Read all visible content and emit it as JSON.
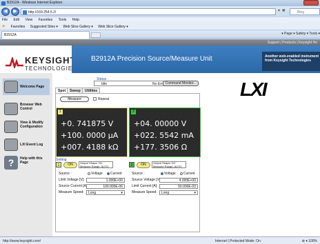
{
  "browser": {
    "window_title": "B2912A - Windows Internet Explorer",
    "url": "http://169.254.5.2/",
    "search_placeholder": "Bing",
    "menu": [
      "File",
      "Edit",
      "View",
      "Favorites",
      "Tools",
      "Help"
    ],
    "favorites": [
      "Favorites",
      "Suggested Sites ▾",
      "Web Slice Gallery ▾",
      "Web Slice Gallery ▾"
    ],
    "tab_title": "B2912A",
    "command_bar": "▾ Page ▾  Safety ▾  Tools ▾",
    "status_url": "http://www.keysight.com/",
    "status_zone": "Internet | Protected Mode: On",
    "zoom": "⊕ ▾ 100%"
  },
  "page": {
    "support_links": "Support | Products | Keysight Ho",
    "logo_top": "KEYSIGHT",
    "logo_bottom": "TECHNOLOGIES",
    "title": "B2912A Precision Source/Measure Unit",
    "promo": "Another web-enabled instrument from Keysight Technologies",
    "lxi": "LXI",
    "sidebar": [
      {
        "label": "Welcome Page"
      },
      {
        "label": "Browser Web Control"
      },
      {
        "label": "View & Modify Configuration"
      },
      {
        "label": "LXI Event Log"
      },
      {
        "label": "Help with this Page"
      }
    ],
    "status_label": "Status",
    "status_value": "Idle",
    "status_errors": "No Errors",
    "command_monitor": "Command Monitor...",
    "tabs": [
      "Spot",
      "Sweep",
      "Utilities"
    ],
    "measure_button": "Measure",
    "repeat_label": "Repeat",
    "setting_label": "Setting",
    "channels": [
      {
        "number": "1",
        "color": "#f2ec7a",
        "voltage": "+0. 741875   V",
        "current": "+100. 0000 μA",
        "resistance": "+007. 4188 kΩ",
        "on_label": "ON",
        "output_info": "Output Shape: DC\nMeasure Range: AUTO",
        "source_label": "Source :",
        "source_options": [
          "Voltage",
          "Current"
        ],
        "source_selected": "Current",
        "limit_label": "Limit Voltage [V]:",
        "limit_value": "1.000E+00",
        "level_label": "Source Current [A]:",
        "level_value": "100.000E-06",
        "speed_label": "Measure Speed:",
        "speed_value": "Long"
      },
      {
        "number": "2",
        "color": "#3ec43e",
        "voltage": "+04. 00000   V",
        "current": "+022. 5542 mA",
        "resistance": "+177. 3506   Ω",
        "on_label": "ON",
        "output_info": "Output Shape: DC\nMeasure Range: AUTO",
        "source_label": "Source :",
        "source_options": [
          "Voltage",
          "Current"
        ],
        "source_selected": "Voltage",
        "limit_label": "Limit Current [A]:",
        "limit_value": "50.000E-03",
        "level_label": "Source Voltage [V]:",
        "level_value": "4.000E+00",
        "speed_label": "Measure Speed:",
        "speed_value": "Long"
      }
    ]
  }
}
